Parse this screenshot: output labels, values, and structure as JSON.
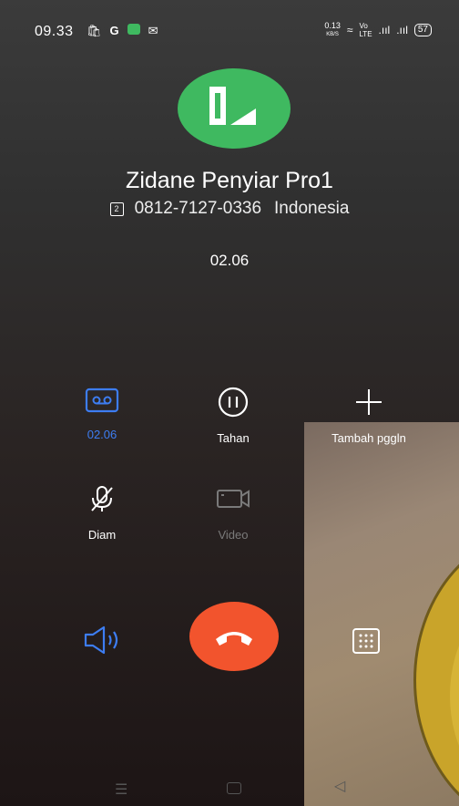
{
  "status_bar": {
    "time": "09.33",
    "left_icons": [
      "bag-icon",
      "g-icon",
      "chat-icon",
      "mail-icon"
    ],
    "network_speed": "0.13",
    "network_unit": "KB/S",
    "battery": "57"
  },
  "contact": {
    "name": "Zidane Penyiar Pro1",
    "sim_slot": "2",
    "number": "0812-7127-0336",
    "country": "Indonesia",
    "avatar_color": "#3fb960"
  },
  "call": {
    "duration": "02.06",
    "end_button_color": "#f2542d"
  },
  "actions": {
    "record_label": "02.06",
    "hold_label": "Tahan",
    "add_label": "Tambah pggln",
    "mute_label": "Diam",
    "video_label": "Video"
  },
  "colors": {
    "accent_blue": "#3d7df2",
    "disabled_gray": "#7a7a7a"
  }
}
